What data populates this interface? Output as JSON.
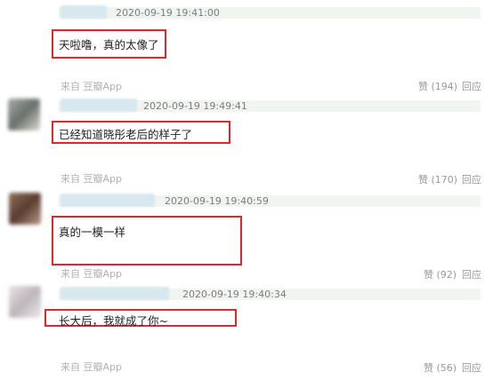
{
  "comments": [
    {
      "timestamp": "2020-09-19 19:41:00",
      "text": "天啦噜，真的太像了",
      "source": "来自 豆瓣App",
      "likes": "赞 (194)",
      "reply": "回应"
    },
    {
      "timestamp": "2020-09-19 19:49:41",
      "text": "已经知道晓彤老后的样子了",
      "source": "来自 豆瓣App",
      "likes": "赞 (170)",
      "reply": "回应"
    },
    {
      "timestamp": "2020-09-19 19:40:59",
      "text": "真的一模一样",
      "source": "来自 豆瓣App",
      "likes": "赞 (92)",
      "reply": "回应"
    },
    {
      "timestamp": "2020-09-19 19:40:34",
      "text": "长大后，我就成了你~",
      "source": "来自 豆瓣App",
      "likes": "赞 (56)",
      "reply": "回应"
    }
  ],
  "colors": {
    "highlight_box": "#e3262b",
    "header_bar": "#f0f5f2",
    "name_blur": "#d7e8ee"
  }
}
